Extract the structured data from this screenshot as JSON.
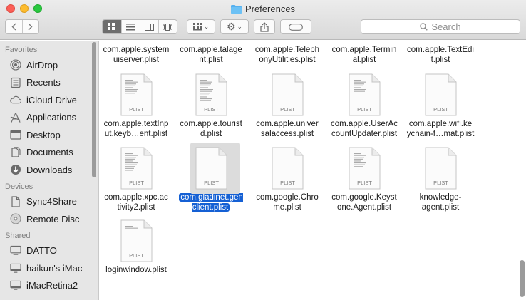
{
  "window": {
    "title": "Preferences"
  },
  "toolbar": {
    "back_icon": "chevron-left-icon",
    "forward_icon": "chevron-right-icon",
    "search_placeholder": "Search"
  },
  "sidebar": {
    "favorites_header": "Favorites",
    "favorites": [
      {
        "label": "AirDrop",
        "icon": "airdrop-icon"
      },
      {
        "label": "Recents",
        "icon": "recents-icon"
      },
      {
        "label": "iCloud Drive",
        "icon": "cloud-icon"
      },
      {
        "label": "Applications",
        "icon": "applications-icon"
      },
      {
        "label": "Desktop",
        "icon": "desktop-icon"
      },
      {
        "label": "Documents",
        "icon": "documents-icon"
      },
      {
        "label": "Downloads",
        "icon": "downloads-icon"
      }
    ],
    "devices_header": "Devices",
    "devices": [
      {
        "label": "Sync4Share",
        "icon": "document-icon"
      },
      {
        "label": "Remote Disc",
        "icon": "disc-icon"
      }
    ],
    "shared_header": "Shared",
    "shared": [
      {
        "label": "DATTO",
        "icon": "monitor-icon"
      },
      {
        "label": "haikun's iMac",
        "icon": "imac-icon"
      },
      {
        "label": "iMacRetina2",
        "icon": "imac-icon"
      }
    ]
  },
  "files": {
    "icon_label": "PLIST",
    "top_row": [
      "com.apple.system\nuiserver.plist",
      "com.apple.talage\nnt.plist",
      "com.apple.Teleph\nonyUtilities.plist",
      "com.apple.Termin\nal.plist",
      "com.apple.TextEdi\nt.plist"
    ],
    "row1": [
      "com.apple.textInp\nut.keyb…ent.plist",
      "com.apple.tourist\nd.plist",
      "com.apple.univer\nsalaccess.plist",
      "com.apple.UserAc\ncountUpdater.plist",
      "com.apple.wifi.ke\nychain-f…mat.plist"
    ],
    "row2": [
      "com.apple.xpc.ac\ntivity2.plist",
      "com.gladinet.gen\nclient.plist",
      "com.google.Chro\nme.plist",
      "com.google.Keyst\none.Agent.plist",
      "knowledge-\nagent.plist"
    ],
    "row3": [
      "loginwindow.plist"
    ],
    "selected": "com.gladinet.gen\nclient.plist"
  }
}
